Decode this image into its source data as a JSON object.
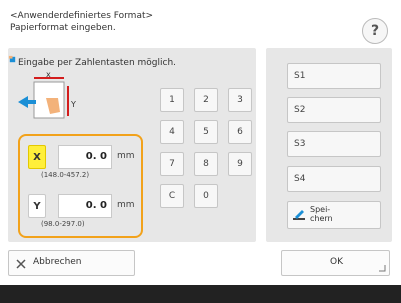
{
  "header": {
    "line1": "<Anwenderdefiniertes Format>",
    "line2": "Papierformat eingeben.",
    "help_label": "?"
  },
  "hint": {
    "text": "Eingabe per Zahlentasten möglich."
  },
  "diagram": {
    "x_label": "x",
    "y_label": "Y"
  },
  "inputs": {
    "x": {
      "axis_label": "X",
      "value": "0. 0",
      "unit": "mm",
      "range": "(148.0-457.2)"
    },
    "y": {
      "axis_label": "Y",
      "value": "0. 0",
      "unit": "mm",
      "range": "(98.0-297.0)"
    }
  },
  "keypad": {
    "keys": [
      "1",
      "2",
      "3",
      "4",
      "5",
      "6",
      "7",
      "8",
      "9",
      "C",
      "0"
    ]
  },
  "presets": {
    "s1": "S1",
    "s2": "S2",
    "s3": "S3",
    "s4": "S4",
    "save_line1": "Spei-",
    "save_line2": "chern"
  },
  "footer": {
    "cancel_label": "Abbrechen",
    "ok_label": "OK"
  },
  "colors": {
    "accent": "#f2a21b",
    "active_key": "#ffef3a",
    "panel_bg": "#e7e7e7",
    "bottom_bar": "#222222"
  }
}
